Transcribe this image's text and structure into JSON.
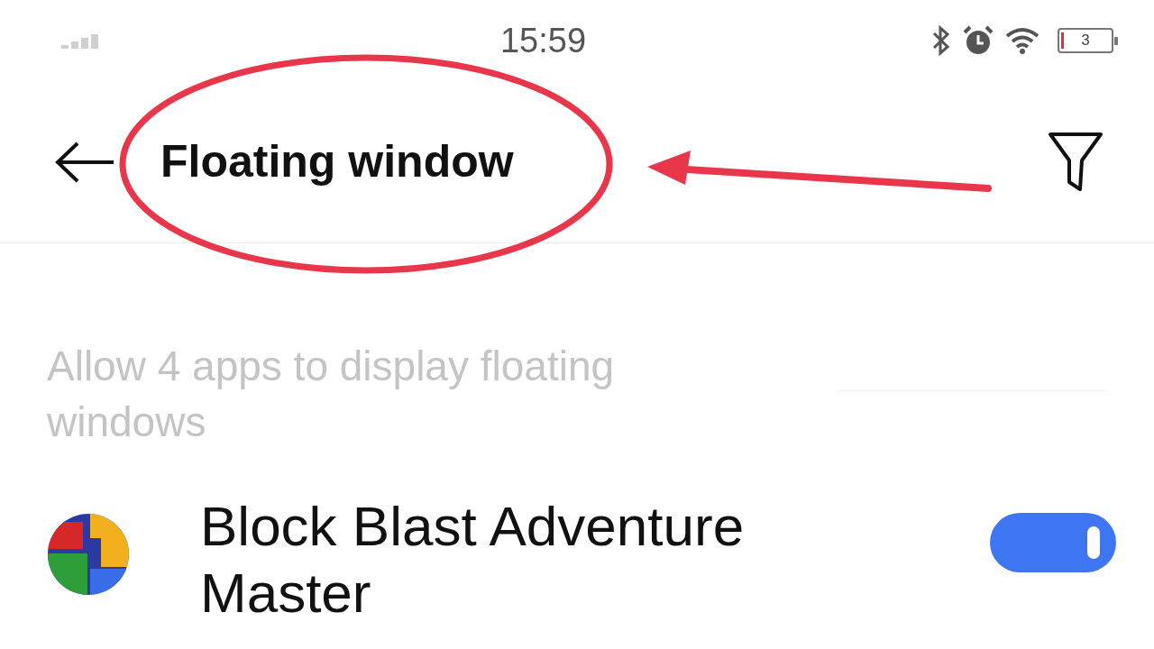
{
  "status_bar": {
    "time": "15:59",
    "battery": "3"
  },
  "header": {
    "title": "Floating window"
  },
  "description": "Allow 4 apps to display floating windows",
  "apps": [
    {
      "name": "Block Blast Adventure Master",
      "on": true
    }
  ]
}
